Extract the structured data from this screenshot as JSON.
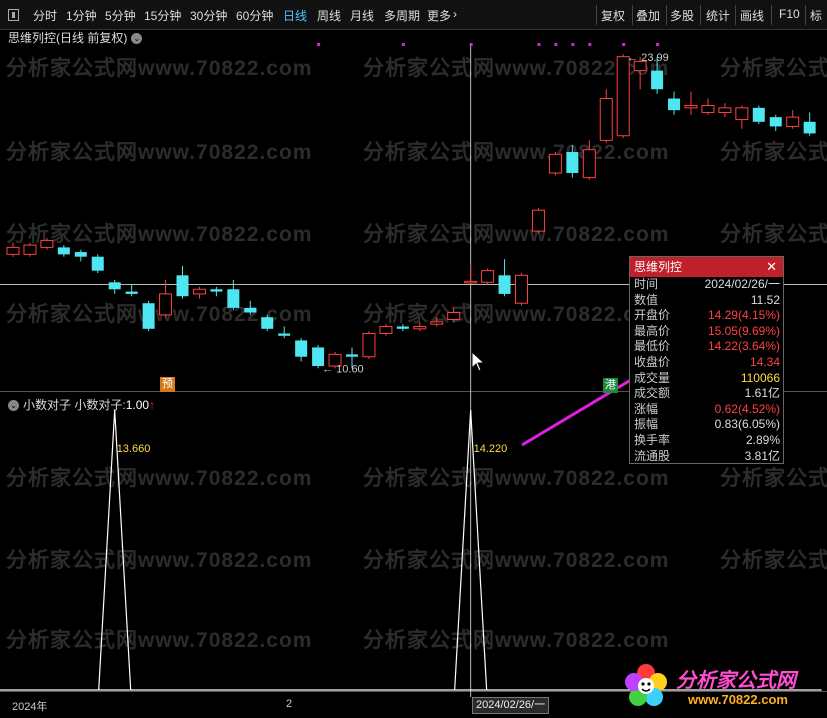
{
  "toolbar": {
    "left_items": [
      "分时",
      "1分钟",
      "5分钟",
      "15分钟",
      "30分钟",
      "60分钟",
      "日线",
      "周线",
      "月线",
      "多周期",
      "更多"
    ],
    "active": "日线",
    "right_items": [
      "复权",
      "叠加",
      "多股",
      "统计",
      "画线",
      "F10",
      "标"
    ]
  },
  "chart": {
    "title": "思维列控(日线 前复权)",
    "high_label": "23.99",
    "low_label": "10.60"
  },
  "indicator": {
    "name": "小数对子",
    "label": "小数对子:",
    "value": "1.00",
    "peak_left": "13.660",
    "peak_right": "14.220"
  },
  "popup": {
    "title": "思维列控",
    "rows": [
      {
        "label": "时间",
        "value": "2024/02/26/一",
        "color": "normal"
      },
      {
        "label": "数值",
        "value": "11.52",
        "color": "normal"
      },
      {
        "label": "开盘价",
        "value": "14.29(4.15%)",
        "color": "red"
      },
      {
        "label": "最高价",
        "value": "15.05(9.69%)",
        "color": "red"
      },
      {
        "label": "最低价",
        "value": "14.22(3.64%)",
        "color": "red"
      },
      {
        "label": "收盘价",
        "value": "14.34",
        "color": "red"
      },
      {
        "label": "成交量",
        "value": "110066",
        "color": "yellow"
      },
      {
        "label": "成交额",
        "value": "1.61亿",
        "color": "normal"
      },
      {
        "label": "涨幅",
        "value": "0.62(4.52%)",
        "color": "red"
      },
      {
        "label": "振幅",
        "value": "0.83(6.05%)",
        "color": "normal"
      },
      {
        "label": "换手率",
        "value": "2.89%",
        "color": "normal"
      },
      {
        "label": "流通股",
        "value": "3.81亿",
        "color": "normal"
      }
    ]
  },
  "badges": {
    "yu": "预",
    "gang": "港"
  },
  "xaxis": {
    "year": "2024年",
    "mid": "2",
    "cursor_date": "2024/02/26/一"
  },
  "watermark": "分析家公式网www.70822.com",
  "logo": {
    "text": "分析家公式网",
    "url": "www.70822.com"
  },
  "chart_data": {
    "type": "candlestick",
    "candles": [
      {
        "o": 15.5,
        "c": 15.8,
        "h": 16.0,
        "l": 15.4
      },
      {
        "o": 15.5,
        "c": 15.9,
        "h": 16.0,
        "l": 15.4
      },
      {
        "o": 15.8,
        "c": 16.1,
        "h": 16.2,
        "l": 15.7
      },
      {
        "o": 15.8,
        "c": 15.5,
        "h": 15.9,
        "l": 15.4
      },
      {
        "o": 15.6,
        "c": 15.4,
        "h": 15.7,
        "l": 15.2
      },
      {
        "o": 15.4,
        "c": 14.8,
        "h": 15.5,
        "l": 14.7
      },
      {
        "o": 14.3,
        "c": 14.0,
        "h": 14.4,
        "l": 13.8
      },
      {
        "o": 13.9,
        "c": 13.8,
        "h": 14.2,
        "l": 13.7
      },
      {
        "o": 13.4,
        "c": 12.3,
        "h": 13.5,
        "l": 12.2
      },
      {
        "o": 12.9,
        "c": 13.8,
        "h": 14.4,
        "l": 12.8
      },
      {
        "o": 14.6,
        "c": 13.7,
        "h": 15.0,
        "l": 13.6
      },
      {
        "o": 13.8,
        "c": 14.0,
        "h": 14.1,
        "l": 13.6
      },
      {
        "o": 14.0,
        "c": 13.9,
        "h": 14.1,
        "l": 13.7
      },
      {
        "o": 14.0,
        "c": 13.2,
        "h": 14.4,
        "l": 13.1
      },
      {
        "o": 13.2,
        "c": 13.0,
        "h": 13.5,
        "l": 12.9
      },
      {
        "o": 12.8,
        "c": 12.3,
        "h": 12.9,
        "l": 12.2
      },
      {
        "o": 12.1,
        "c": 12.0,
        "h": 12.4,
        "l": 11.9
      },
      {
        "o": 11.8,
        "c": 11.1,
        "h": 11.9,
        "l": 10.9
      },
      {
        "o": 11.5,
        "c": 10.7,
        "h": 11.6,
        "l": 10.6
      },
      {
        "o": 10.7,
        "c": 11.2,
        "h": 11.3,
        "l": 10.6
      },
      {
        "o": 11.2,
        "c": 11.1,
        "h": 11.5,
        "l": 10.6
      },
      {
        "o": 11.1,
        "c": 12.1,
        "h": 12.2,
        "l": 11.0
      },
      {
        "o": 12.1,
        "c": 12.4,
        "h": 12.5,
        "l": 12.0
      },
      {
        "o": 12.4,
        "c": 12.3,
        "h": 12.5,
        "l": 12.2
      },
      {
        "o": 12.3,
        "c": 12.4,
        "h": 12.6,
        "l": 12.2
      },
      {
        "o": 12.5,
        "c": 12.6,
        "h": 12.8,
        "l": 12.4
      },
      {
        "o": 12.7,
        "c": 13.0,
        "h": 13.2,
        "l": 12.6
      },
      {
        "o": 14.29,
        "c": 14.34,
        "h": 15.05,
        "l": 14.22
      },
      {
        "o": 14.3,
        "c": 14.8,
        "h": 14.9,
        "l": 14.2
      },
      {
        "o": 14.6,
        "c": 13.8,
        "h": 15.3,
        "l": 13.7
      },
      {
        "o": 13.4,
        "c": 14.6,
        "h": 14.7,
        "l": 13.3
      },
      {
        "o": 16.5,
        "c": 17.4,
        "h": 17.5,
        "l": 16.4
      },
      {
        "o": 19.0,
        "c": 19.8,
        "h": 19.9,
        "l": 18.9
      },
      {
        "o": 19.9,
        "c": 19.0,
        "h": 20.2,
        "l": 18.8
      },
      {
        "o": 18.8,
        "c": 20.0,
        "h": 20.4,
        "l": 18.7
      },
      {
        "o": 20.4,
        "c": 22.2,
        "h": 22.6,
        "l": 20.3
      },
      {
        "o": 20.6,
        "c": 24.0,
        "h": 24.1,
        "l": 20.5
      },
      {
        "o": 23.4,
        "c": 23.8,
        "h": 23.99,
        "l": 22.6
      },
      {
        "o": 23.4,
        "c": 22.6,
        "h": 23.99,
        "l": 22.4
      },
      {
        "o": 22.2,
        "c": 21.7,
        "h": 22.5,
        "l": 21.5
      },
      {
        "o": 21.8,
        "c": 21.9,
        "h": 22.5,
        "l": 21.5
      },
      {
        "o": 21.6,
        "c": 21.9,
        "h": 22.2,
        "l": 21.5
      },
      {
        "o": 21.6,
        "c": 21.8,
        "h": 22.0,
        "l": 21.4
      },
      {
        "o": 21.3,
        "c": 21.8,
        "h": 21.9,
        "l": 20.9
      },
      {
        "o": 21.8,
        "c": 21.2,
        "h": 21.9,
        "l": 21.1
      },
      {
        "o": 21.4,
        "c": 21.0,
        "h": 21.5,
        "l": 20.8
      },
      {
        "o": 21.0,
        "c": 21.4,
        "h": 21.7,
        "l": 20.9
      },
      {
        "o": 21.2,
        "c": 20.7,
        "h": 21.6,
        "l": 20.6
      }
    ],
    "cursor_index": 27,
    "indicator_series": {
      "name": "小数对子",
      "values": [
        0,
        0,
        0,
        0,
        0,
        0,
        1,
        0,
        0,
        0,
        0,
        0,
        0,
        0,
        0,
        0,
        0,
        0,
        0,
        0,
        0,
        0,
        0,
        0,
        0,
        0,
        0,
        1,
        0,
        0,
        0,
        0,
        0,
        0,
        0,
        0,
        0,
        0,
        0,
        0,
        0,
        0,
        0,
        0,
        0,
        0,
        0,
        0
      ],
      "ylim": [
        0,
        1
      ]
    },
    "top_signal_dots": [
      18,
      23,
      27,
      31,
      32,
      33,
      34,
      36,
      38
    ]
  },
  "colors": {
    "up": "#ff4040",
    "down": "#4ee6f0",
    "accent": "#4ec4ff",
    "arrow": "#e020e0"
  }
}
